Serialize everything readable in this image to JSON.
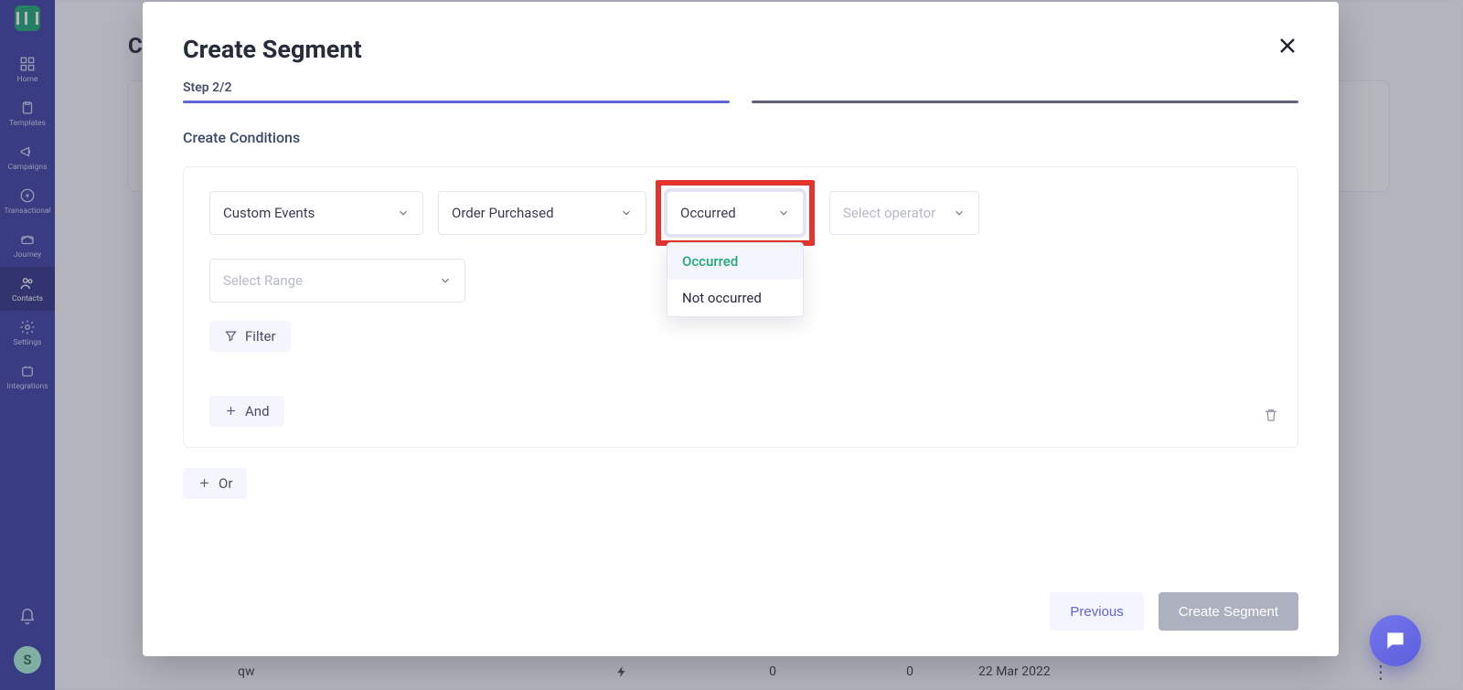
{
  "sidebar": {
    "items": [
      {
        "label": "Home"
      },
      {
        "label": "Templates"
      },
      {
        "label": "Campaigns"
      },
      {
        "label": "Transactional"
      },
      {
        "label": "Journey"
      },
      {
        "label": "Contacts"
      },
      {
        "label": "Settings"
      },
      {
        "label": "Integrations"
      }
    ],
    "avatar_initial": "S"
  },
  "page": {
    "heading_truncated": "C",
    "row": {
      "name": "qw",
      "count1": "0",
      "count2": "0",
      "date": "22 Mar 2022"
    }
  },
  "modal": {
    "title": "Create Segment",
    "step_label": "Step 2/2",
    "subtitle": "Create Conditions",
    "condition": {
      "event_type": "Custom Events",
      "event_name": "Order Purchased",
      "occurrence": {
        "selected": "Occurred",
        "options": [
          "Occurred",
          "Not occurred"
        ]
      },
      "operator_placeholder": "Select operator",
      "range_placeholder": "Select Range",
      "filter_label": "Filter",
      "and_label": "And"
    },
    "or_label": "Or",
    "footer": {
      "previous": "Previous",
      "create": "Create Segment"
    }
  }
}
